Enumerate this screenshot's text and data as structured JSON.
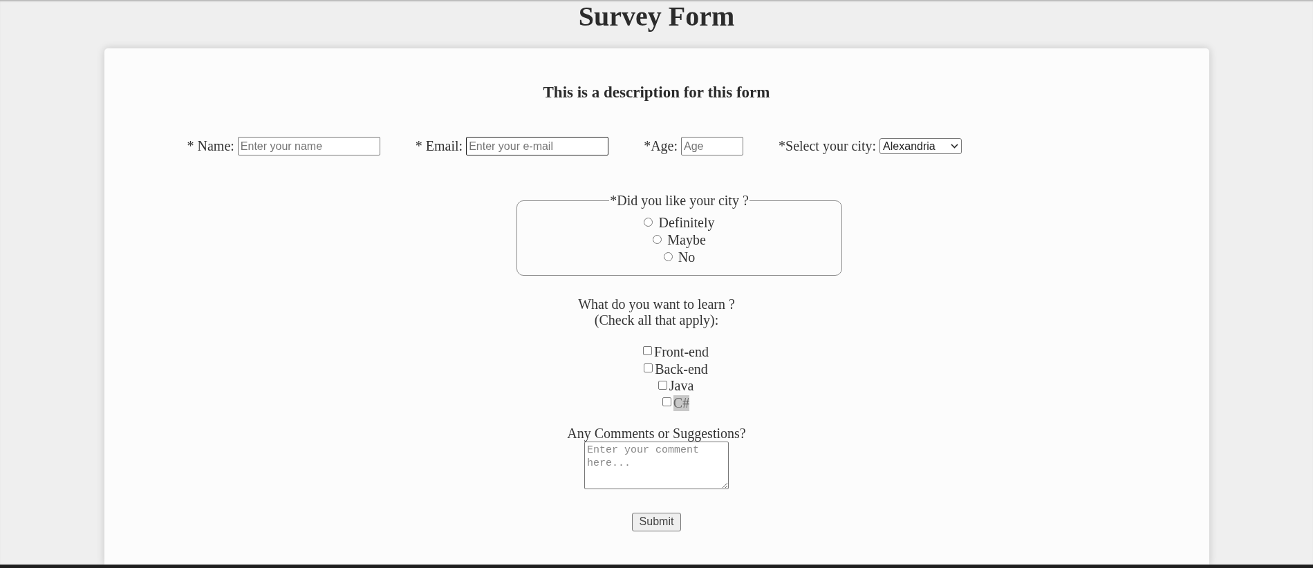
{
  "title": "Survey Form",
  "description": "This is a description for this form",
  "fields": [
    {
      "kind": "text",
      "label": "* Name:",
      "placeholder": "Enter your name",
      "focused": false
    },
    {
      "kind": "text",
      "label": "* Email:",
      "placeholder": "Enter your e-mail",
      "focused": true
    },
    {
      "kind": "number",
      "label": "*Age:",
      "placeholder": "Age",
      "focused": false
    },
    {
      "kind": "select",
      "label": "*Select your city:",
      "value": "Alexandria",
      "focused": false
    }
  ],
  "city_rating": {
    "legend": "*Did you like your city ?",
    "options": [
      {
        "label": "Definitely",
        "selected": false
      },
      {
        "label": "Maybe",
        "selected": false
      },
      {
        "label": "No",
        "selected": false
      }
    ]
  },
  "learning": {
    "prompt": "What do you want to learn ?",
    "hint": "(Check all that apply):",
    "options": [
      {
        "label": "Front-end",
        "checked": false,
        "highlighted": false
      },
      {
        "label": "Back-end",
        "checked": false,
        "highlighted": false
      },
      {
        "label": "Java",
        "checked": false,
        "highlighted": false
      },
      {
        "label": "C#",
        "checked": false,
        "highlighted": true
      }
    ]
  },
  "comments": {
    "label": "Any Comments or Suggestions?",
    "placeholder": "Enter your comment here..."
  },
  "submit": {
    "label": "Submit"
  }
}
